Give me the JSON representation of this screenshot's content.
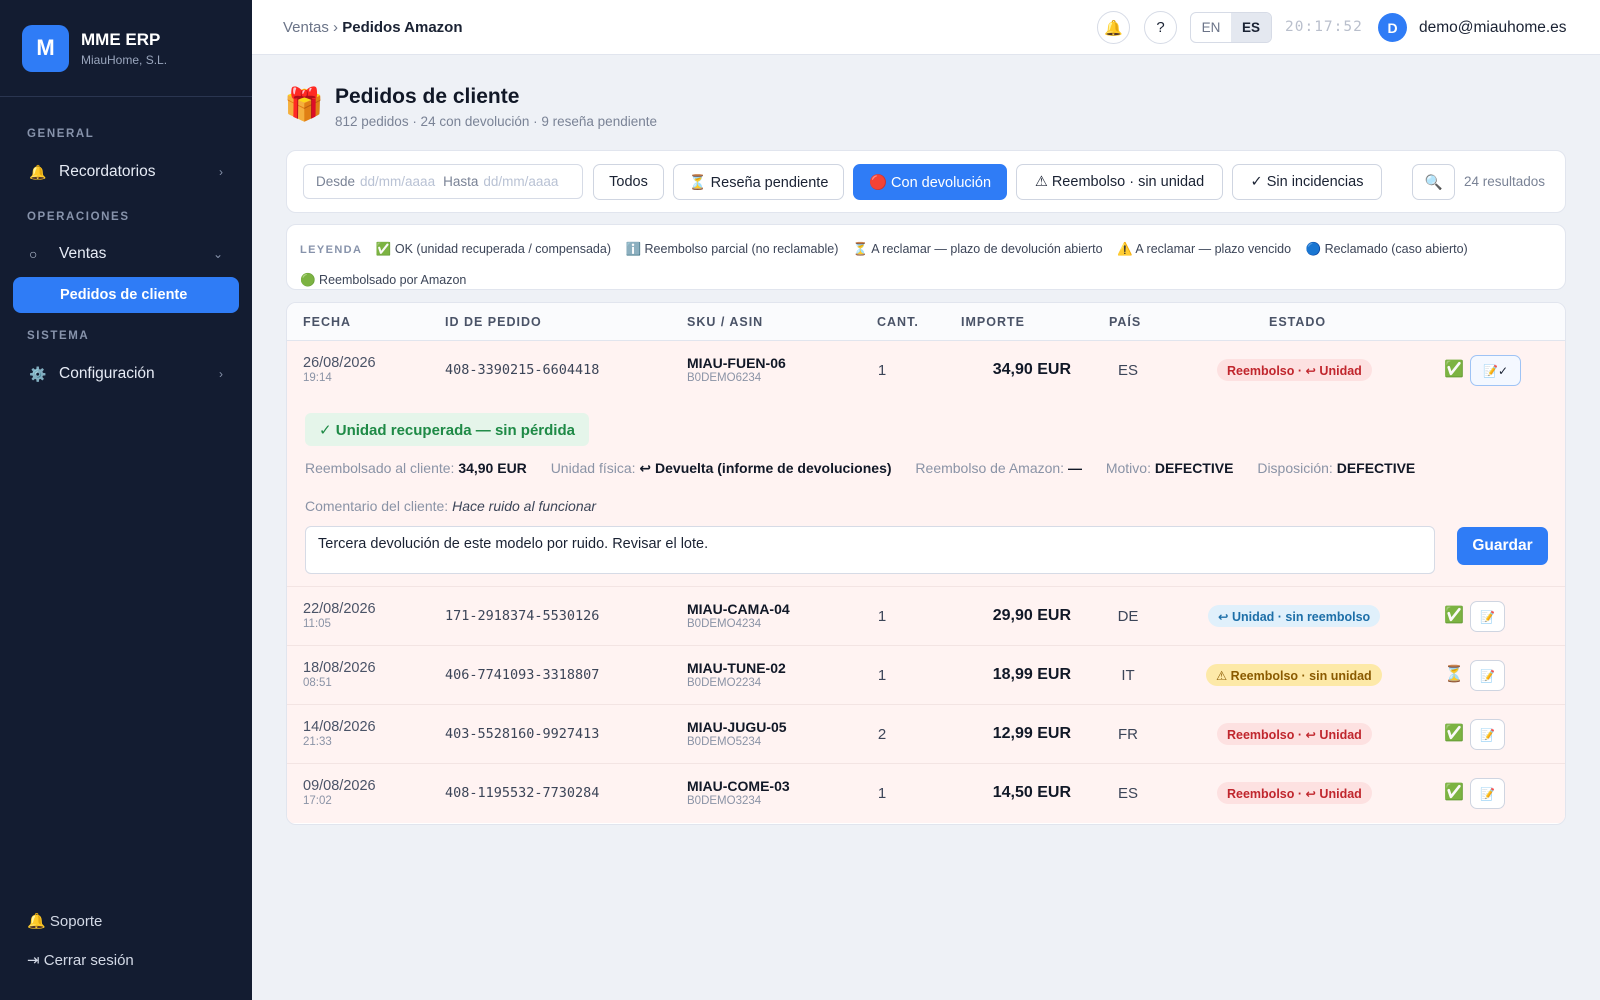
{
  "app": {
    "logo_letter": "M",
    "name": "MME ERP",
    "company": "MiauHome, S.L."
  },
  "sidebar": {
    "sections": [
      "GENERAL",
      "OPERACIONES",
      "SISTEMA"
    ],
    "items": [
      {
        "label": "Recordatorios",
        "icon": "🔔"
      },
      {
        "label": "Ventas",
        "icon": "○"
      },
      {
        "label": "Pedidos de cliente"
      },
      {
        "label": "Configuración",
        "icon": "⚙️"
      }
    ],
    "footer": {
      "support": "🔔 Soporte",
      "logout": "⇥ Cerrar sesión"
    }
  },
  "topbar": {
    "breadcrumb_parent": "Ventas",
    "breadcrumb_sep": "›",
    "breadcrumb_current": "Pedidos Amazon",
    "bell": "🔔",
    "help": "?",
    "lang_en": "EN",
    "lang_es": "ES",
    "clock": "20:17:52",
    "avatar": "D",
    "user": "demo@miauhome.es"
  },
  "page": {
    "icon": "🎁",
    "title": "Pedidos de cliente",
    "subtitle": "812 pedidos · 24 con devolución · 9 reseña pendiente"
  },
  "filters": {
    "from_label": "Desde",
    "from_placeholder": "dd/mm/aaaa",
    "to_label": "Hasta",
    "to_placeholder": "dd/mm/aaaa",
    "buttons": [
      "Todos",
      "⏳ Reseña pendiente",
      "🔴 Con devolución",
      "⚠ Reembolso · sin unidad",
      "✓ Sin incidencias"
    ],
    "active": "🔴 Con devolución",
    "search_icon": "🔍",
    "results": "24 resultados"
  },
  "legend": {
    "title": "LEYENDA",
    "items": [
      "✅ OK (unidad recuperada / compensada)",
      "ℹ️ Reembolso parcial (no reclamable)",
      "⏳ A reclamar — plazo de devolución abierto",
      "⚠️ A reclamar — plazo vencido",
      "🔵 Reclamado (caso abierto)",
      "🟢 Reembolsado por Amazon"
    ]
  },
  "table": {
    "headers": [
      "FECHA",
      "ID DE PEDIDO",
      "SKU / ASIN",
      "CANT.",
      "IMPORTE",
      "PAÍS",
      "ESTADO"
    ],
    "rows": [
      {
        "date": "26/08/2026",
        "time": "19:14",
        "order_id": "408-3390215-6604418",
        "sku": "MIAU-FUEN-06",
        "asin": "B0DEMO6234",
        "qty": "1",
        "amount": "34,90 EUR",
        "country": "ES",
        "status": "Reembolso · ↩ Unidad",
        "status_color": "red",
        "icon": "✅",
        "action": "📝✓"
      },
      {
        "date": "22/08/2026",
        "time": "11:05",
        "order_id": "171-2918374-5530126",
        "sku": "MIAU-CAMA-04",
        "asin": "B0DEMO4234",
        "qty": "1",
        "amount": "29,90 EUR",
        "country": "DE",
        "status": "↩ Unidad · sin reembolso",
        "status_color": "blue",
        "icon": "✅",
        "action": "📝"
      },
      {
        "date": "18/08/2026",
        "time": "08:51",
        "order_id": "406-7741093-3318807",
        "sku": "MIAU-TUNE-02",
        "asin": "B0DEMO2234",
        "qty": "1",
        "amount": "18,99 EUR",
        "country": "IT",
        "status": "⚠ Reembolso · sin unidad",
        "status_color": "yellow",
        "icon": "⏳",
        "action": "📝"
      },
      {
        "date": "14/08/2026",
        "time": "21:33",
        "order_id": "403-5528160-9927413",
        "sku": "MIAU-JUGU-05",
        "asin": "B0DEMO5234",
        "qty": "2",
        "amount": "12,99 EUR",
        "country": "FR",
        "status": "Reembolso · ↩ Unidad",
        "status_color": "red",
        "icon": "✅",
        "action": "📝"
      },
      {
        "date": "09/08/2026",
        "time": "17:02",
        "order_id": "408-1195532-7730284",
        "sku": "MIAU-COME-03",
        "asin": "B0DEMO3234",
        "qty": "1",
        "amount": "14,50 EUR",
        "country": "ES",
        "status": "Reembolso · ↩ Unidad",
        "status_color": "red",
        "icon": "✅",
        "action": "📝"
      }
    ],
    "detail": {
      "banner": "✓ Unidad recuperada — sin pérdida",
      "refunded_label": "Reembolsado al cliente:",
      "refunded_value": "34,90 EUR",
      "unit_label": "Unidad física:",
      "unit_value": "↩ Devuelta (informe de devoluciones)",
      "amazon_label": "Reembolso de Amazon:",
      "amazon_value": "—",
      "reason_label": "Motivo:",
      "reason_value": "DEFECTIVE",
      "disposition_label": "Disposición:",
      "disposition_value": "DEFECTIVE",
      "comment_label": "Comentario del cliente:",
      "comment_value": "Hace ruido al funcionar",
      "note_value": "Tercera devolución de este modelo por ruido. Revisar el lote.",
      "save_label": "Guardar"
    }
  },
  "colors": {
    "accent": "#2f7cf6",
    "sidebar": "#131c31",
    "row_bg": "#fff3f2"
  }
}
